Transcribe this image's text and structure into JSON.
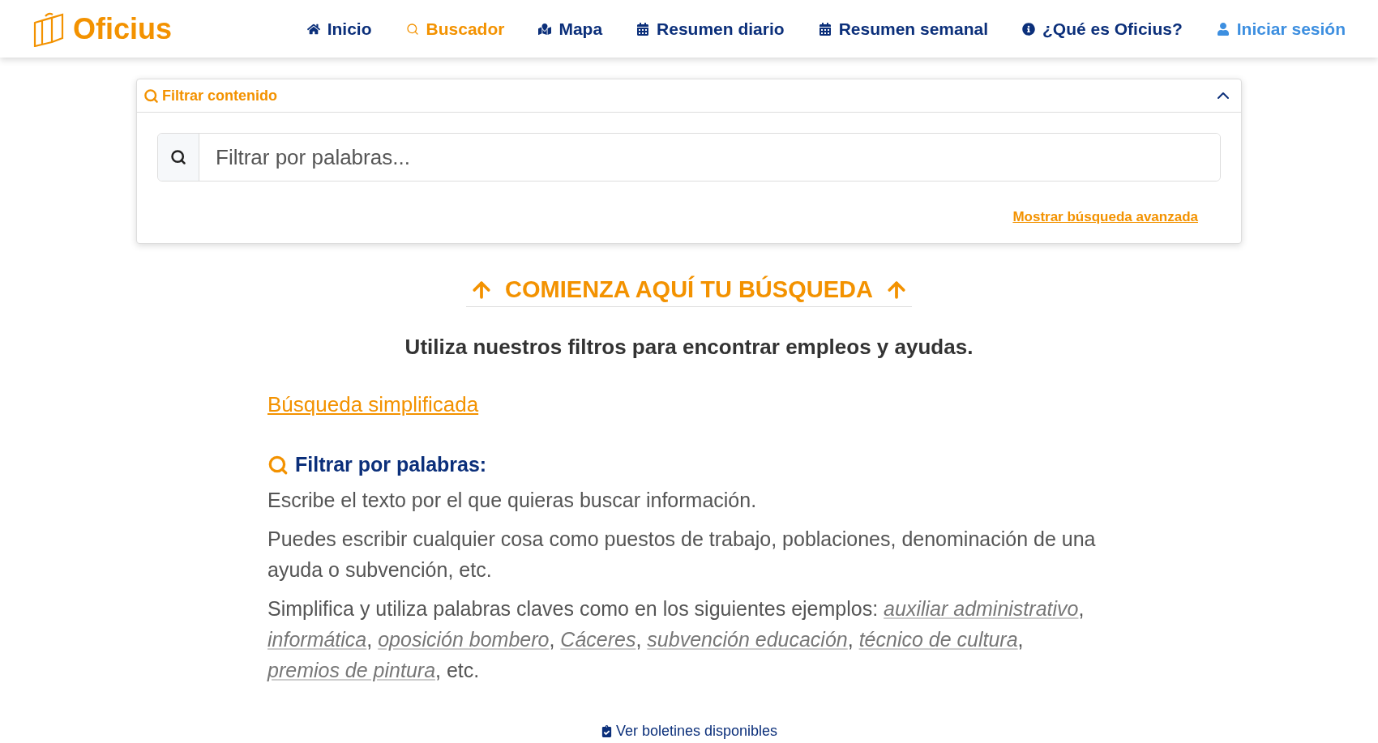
{
  "brand": {
    "name": "Oficius"
  },
  "nav": [
    {
      "label": "Inicio",
      "kind": "link",
      "selected": false
    },
    {
      "label": "Buscador",
      "kind": "link",
      "selected": true
    },
    {
      "label": "Mapa",
      "kind": "link",
      "selected": false
    },
    {
      "label": "Resumen diario",
      "kind": "link",
      "selected": false
    },
    {
      "label": "Resumen semanal",
      "kind": "link",
      "selected": false
    },
    {
      "label": "¿Qué es Oficius?",
      "kind": "link",
      "selected": false
    },
    {
      "label": "Iniciar sesión",
      "kind": "login",
      "selected": false
    }
  ],
  "filter_panel": {
    "title": "Filtrar contenido",
    "expanded": true,
    "search": {
      "placeholder": "Filtrar por palabras..."
    },
    "advanced_link": "Mostrar búsqueda avanzada"
  },
  "hero": {
    "title": "COMIENZA AQUÍ TU BÚSQUEDA",
    "subtitle": "Utiliza nuestros filtros para encontrar empleos y ayudas."
  },
  "simple_link": "Búsqueda simplificada",
  "help": {
    "heading": "Filtrar por palabras:",
    "paragraphs": [
      [
        {
          "kind": "plain",
          "text": "Escribe el texto por el que quieras buscar información."
        }
      ],
      [
        {
          "kind": "plain",
          "text": "Puedes escribir cualquier cosa como puestos de trabajo, poblaciones, denominación de una ayuda o subvención, etc."
        }
      ],
      [
        {
          "kind": "plain",
          "text": "Simplifica y utiliza palabras claves como en los siguientes ejemplos: "
        },
        {
          "kind": "example",
          "text": "auxiliar administrativo"
        },
        {
          "kind": "plain",
          "text": ", "
        },
        {
          "kind": "example",
          "text": "informática"
        },
        {
          "kind": "plain",
          "text": ", "
        },
        {
          "kind": "example",
          "text": "oposición bombero"
        },
        {
          "kind": "plain",
          "text": ", "
        },
        {
          "kind": "example",
          "text": "Cáceres"
        },
        {
          "kind": "plain",
          "text": ", "
        },
        {
          "kind": "example",
          "text": "subvención educación"
        },
        {
          "kind": "plain",
          "text": ", "
        },
        {
          "kind": "example",
          "text": "técnico de cultura"
        },
        {
          "kind": "plain",
          "text": ", "
        },
        {
          "kind": "example",
          "text": "premios de pintura"
        },
        {
          "kind": "plain",
          "text": ", etc."
        }
      ]
    ]
  },
  "footer_link": "Ver boletines disponibles"
}
